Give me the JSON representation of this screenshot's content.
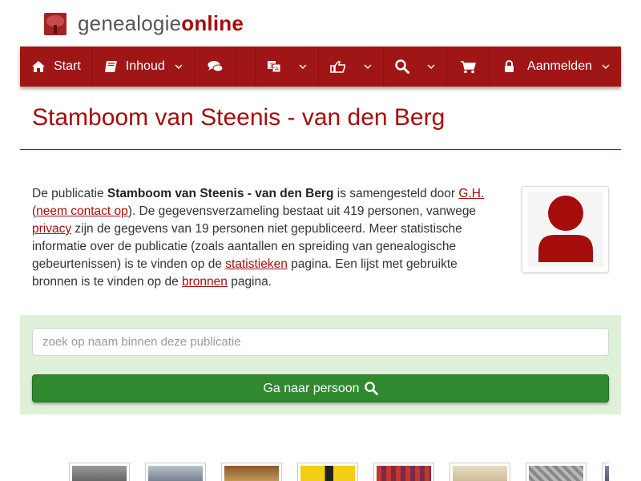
{
  "brand": {
    "prefix": "genealogie",
    "suffix": "online"
  },
  "nav": {
    "start": "Start",
    "inhoud": "Inhoud",
    "aanmelden": "Aanmelden"
  },
  "page": {
    "title": "Stamboom van Steenis - van den Berg"
  },
  "intro": {
    "t1": "De publicatie ",
    "pub_name": "Stamboom van Steenis - van den Berg",
    "t2": " is samengesteld door ",
    "author_link": "G.H.",
    "t3": " (",
    "contact_link": "neem contact op",
    "t4": "). De gegevensverzameling bestaat uit 419 personen, vanwege ",
    "privacy_link": "privacy",
    "t5": " zijn de gegevens van 19 personen niet gepubliceerd. Meer statistische informatie over de publicatie (zoals aantallen en spreiding van genealogische gebeurtenissen) is te vinden op de ",
    "stats_link": "statistieken",
    "t6": " pagina. Een lijst met gebruikte bronnen is te vinden op de ",
    "sources_link": "bronnen",
    "t7": " pagina."
  },
  "search": {
    "placeholder": "zoek op naam binnen deze publicatie",
    "button": "Ga naar persoon"
  },
  "colors": {
    "brand_red": "#a01616",
    "title_red": "#a50c0c",
    "panel_green": "#dff0d8",
    "button_green": "#2f8a2f"
  },
  "icons": [
    "home-icon",
    "book-icon",
    "comments-icon",
    "translate-icon",
    "thumbs-up-icon",
    "search-icon",
    "cart-icon",
    "lock-icon",
    "user-icon"
  ]
}
